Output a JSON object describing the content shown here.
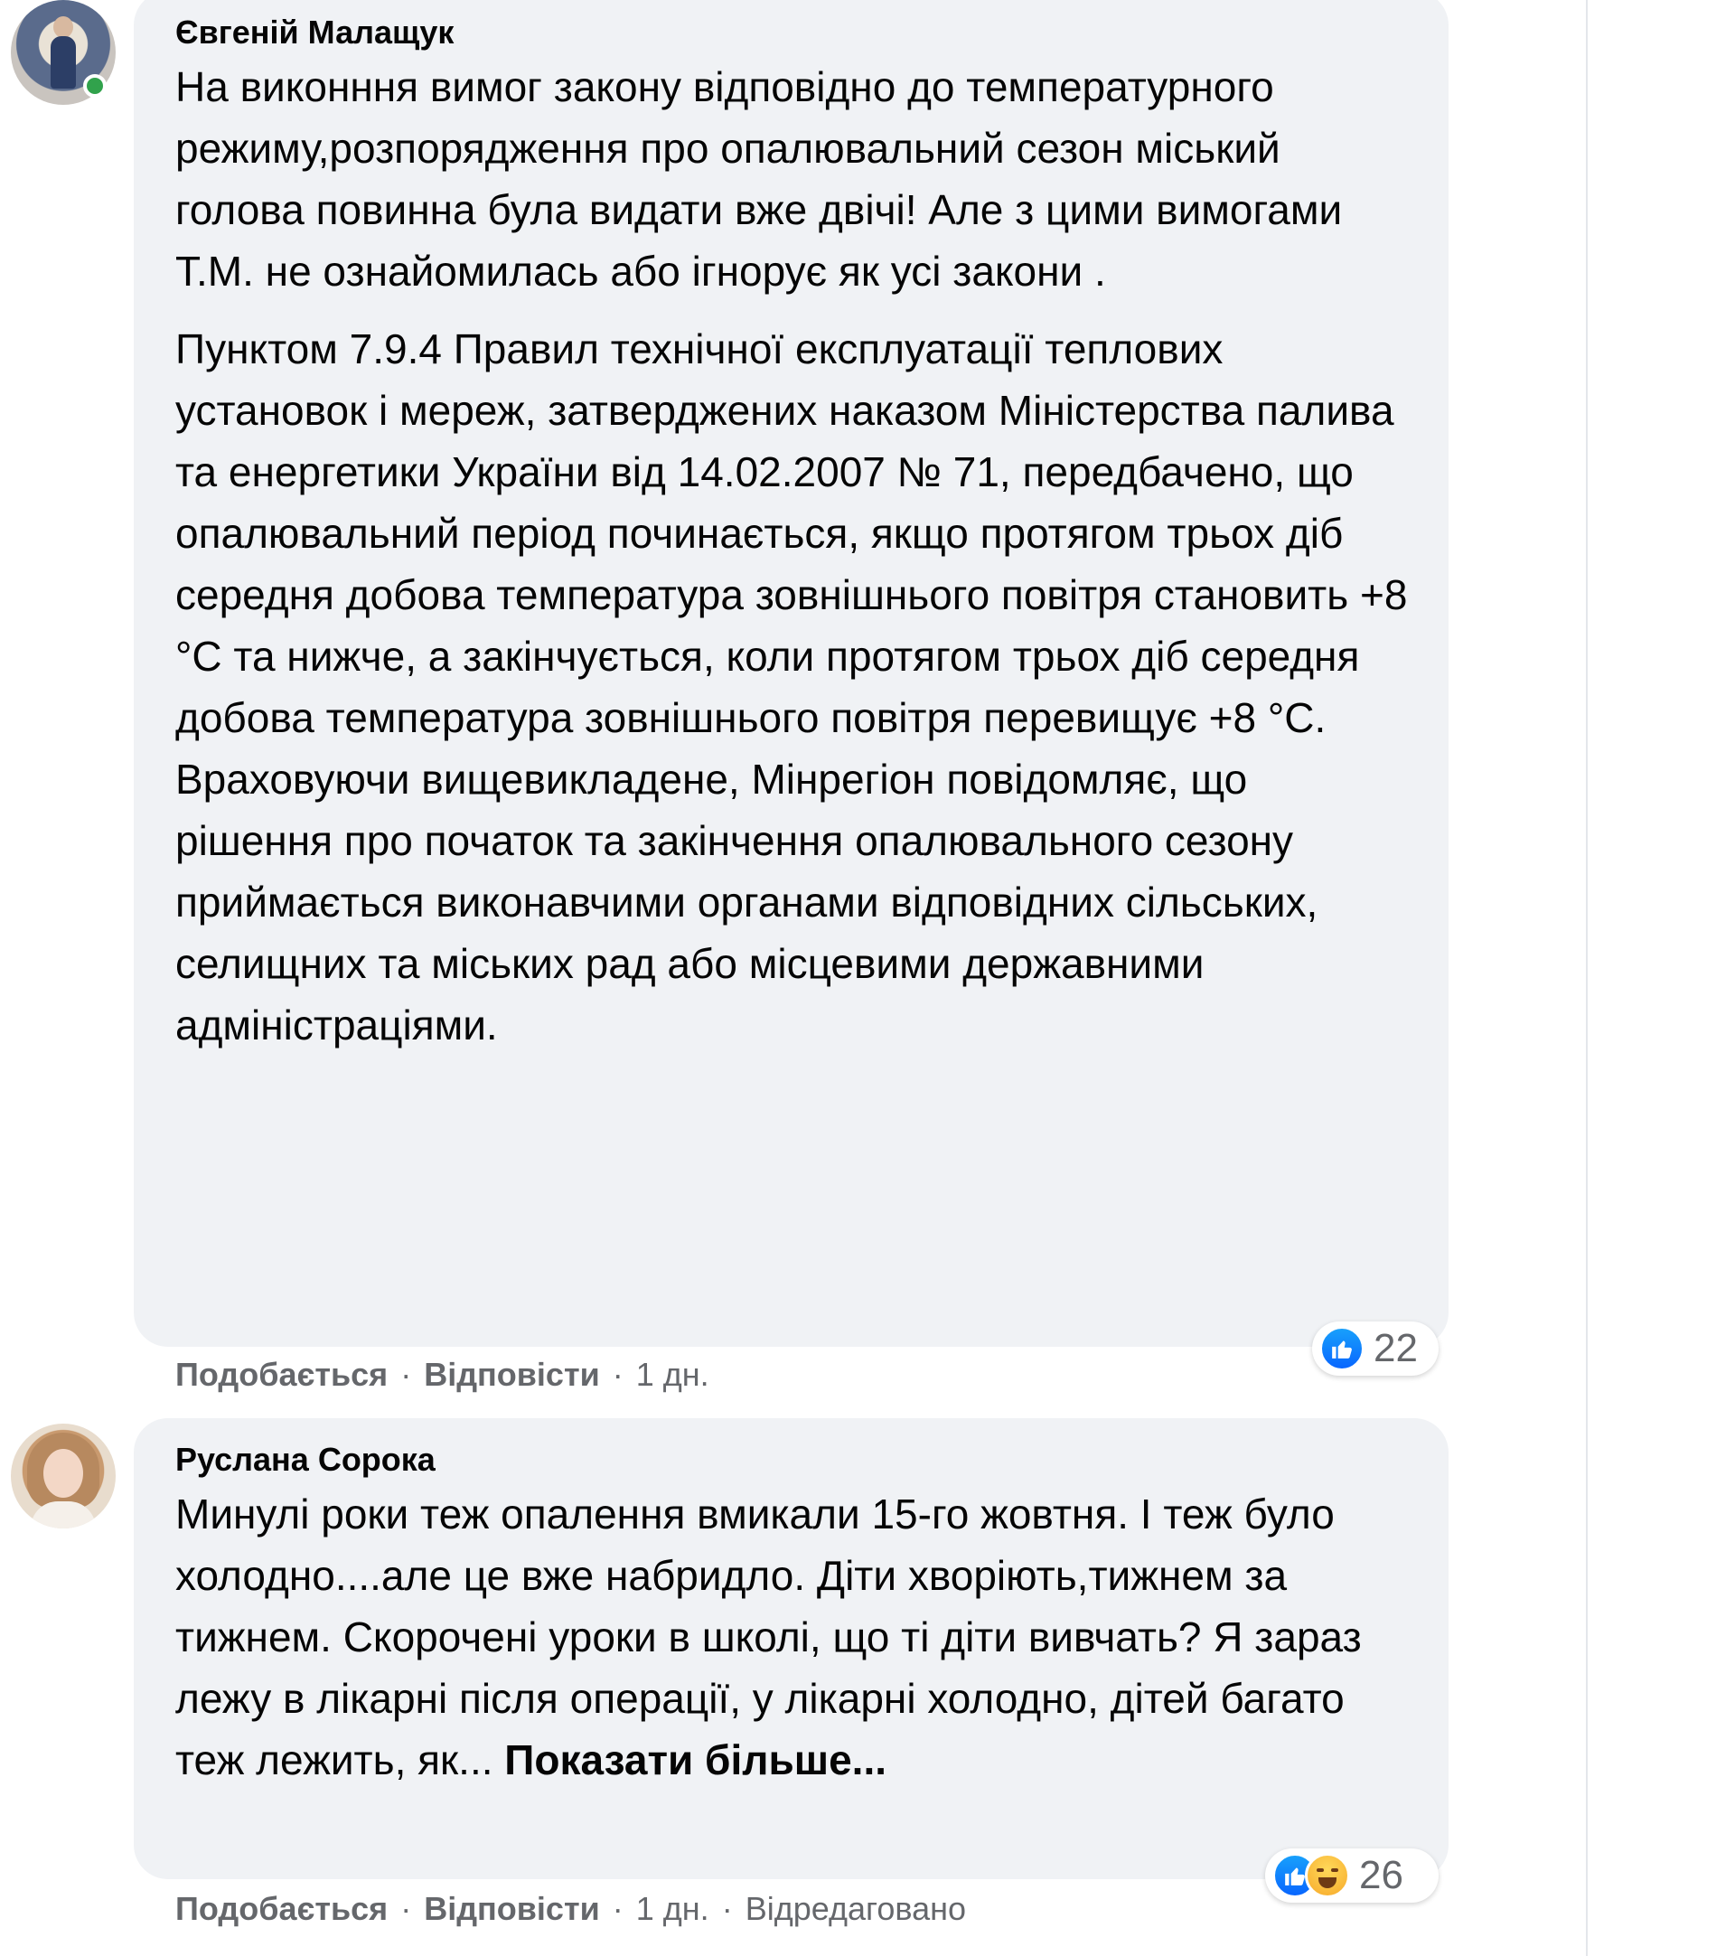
{
  "comments": [
    {
      "author": "Євгеній Малащук",
      "online": true,
      "paragraphs": [
        "На виконння вимог закону відповідно до температурного режиму,розпорядження про опалювальний сезон міський голова повинна була видати вже двічі! Але з цими вимогами Т.М. не ознайомилась або ігнорує як усі закони .",
        "Пунктом 7.9.4 Правил технічної експлуатації теплових установок і мереж, затверджених наказом Міністерства палива та енергетики України від 14.02.2007 № 71, передбачено, що опалювальний період починається, якщо протягом трьох діб середня добова температура зовнішнього повітря становить +8 °С та нижче, а закінчується, коли протягом трьох діб середня добова температура зовнішнього повітря перевищує +8 °С. Враховуючи вищевикладене, Мінрегіон повідомляє, що рішення про початок та закінчення опалювального сезону приймається виконавчими органами відповідних сільських, селищних та міських рад або місцевими державними адміністраціями."
      ],
      "reactions": {
        "icons": [
          "like-icon"
        ],
        "count": "22"
      },
      "actions": {
        "like": "Подобається",
        "reply": "Відповісти",
        "time": "1 дн.",
        "dot": "·"
      }
    },
    {
      "author": "Руслана Сорока",
      "online": false,
      "text": "Минулі роки теж опалення вмикали 15-го жовтня. І теж було холодно....але це вже набридло. Діти хворіють,тижнем за тижнем. Скорочені уроки в школі, що ті діти вивчать? Я зараз лежу в лікарні після операції, у лікарні холодно, дітей багато теж лежить, як...",
      "see_more": "Показати більше...",
      "reactions": {
        "icons": [
          "like-icon",
          "haha-icon"
        ],
        "count": "26"
      },
      "actions": {
        "like": "Подобається",
        "reply": "Відповісти",
        "time": "1 дн.",
        "edited": "Відредаговано",
        "dot": "·"
      }
    }
  ]
}
